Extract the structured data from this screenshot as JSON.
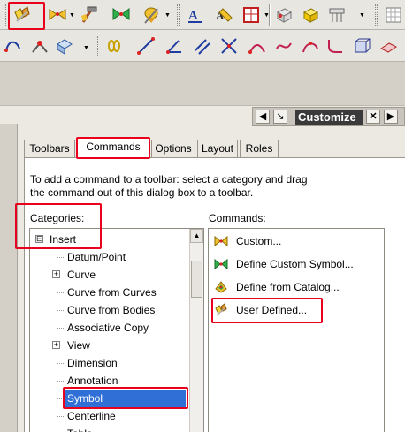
{
  "toolbar_row1": {
    "buttons": [
      "user-defined-symbol-icon",
      "custom-symbol-icon",
      "hammer-icon",
      "define-custom-symbol-icon",
      "catalog-symbol-icon",
      "text-annotation-icon",
      "edit-text-icon",
      "table-icon",
      "view-box-icon",
      "solid-box-icon",
      "gdt-icon",
      "grid-icon"
    ]
  },
  "toolbar_row2": {
    "buttons": [
      "curve-snap-icon",
      "point-options-icon",
      "view-orient-icon",
      "link-icon",
      "line-segment-icon",
      "angle-icon",
      "parallel-icon",
      "intersect-icon",
      "arc-icon",
      "curve-icon",
      "spline-icon",
      "fillet-icon",
      "box-icon",
      "plane-icon"
    ]
  },
  "panel": {
    "title": "Customize",
    "tabs": [
      "Toolbars",
      "Commands",
      "Options",
      "Layout",
      "Roles"
    ],
    "active_tab": "Commands",
    "instruction_line1": "To add a command to a toolbar: select a category and drag",
    "instruction_line2": "the command out of this dialog box to a toolbar.",
    "categories_label": "Categories:",
    "commands_label": "Commands:"
  },
  "categories": [
    {
      "label": "Insert",
      "expander": "⊟"
    },
    {
      "label": "Datum/Point",
      "expander": ""
    },
    {
      "label": "Curve",
      "expander": "+"
    },
    {
      "label": "Curve from Curves",
      "expander": ""
    },
    {
      "label": "Curve from Bodies",
      "expander": ""
    },
    {
      "label": "Associative Copy",
      "expander": ""
    },
    {
      "label": "View",
      "expander": "+"
    },
    {
      "label": "Dimension",
      "expander": ""
    },
    {
      "label": "Annotation",
      "expander": ""
    },
    {
      "label": "Symbol",
      "expander": ""
    },
    {
      "label": "Centerline",
      "expander": ""
    },
    {
      "label": "Table",
      "expander": ""
    }
  ],
  "selected_category": "Symbol",
  "commands": [
    {
      "label": "Custom...",
      "icon": "custom-symbol-icon"
    },
    {
      "label": "Define Custom Symbol...",
      "icon": "define-custom-symbol-icon"
    },
    {
      "label": "Define from Catalog...",
      "icon": "catalog-symbol-icon"
    },
    {
      "label": "User Defined...",
      "icon": "user-defined-symbol-icon"
    }
  ],
  "colors": {
    "highlight_red": "#e8001c",
    "selection_blue": "#2f6fd6",
    "panel_title_bg": "#3a3a3a"
  }
}
